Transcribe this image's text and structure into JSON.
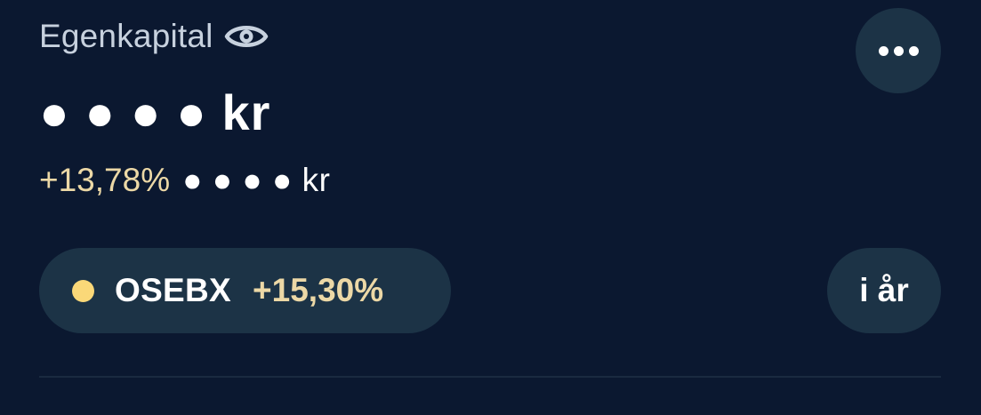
{
  "header": {
    "title": "Egenkapital",
    "visibility_icon": "eye-icon",
    "more_icon": "more-horizontal-icon"
  },
  "balance": {
    "masked_value": "● ● ● ● kr"
  },
  "change": {
    "percent": "+13,78%",
    "masked_amount": "● ● ● ● kr"
  },
  "benchmark": {
    "name": "OSEBX",
    "change": "+15,30%",
    "dot_color": "#fad878"
  },
  "period": {
    "label": "i år"
  },
  "colors": {
    "background": "#0b1830",
    "surface": "#1c3346",
    "positive_text": "#ecd8a6",
    "muted_text": "#c7d1de"
  }
}
